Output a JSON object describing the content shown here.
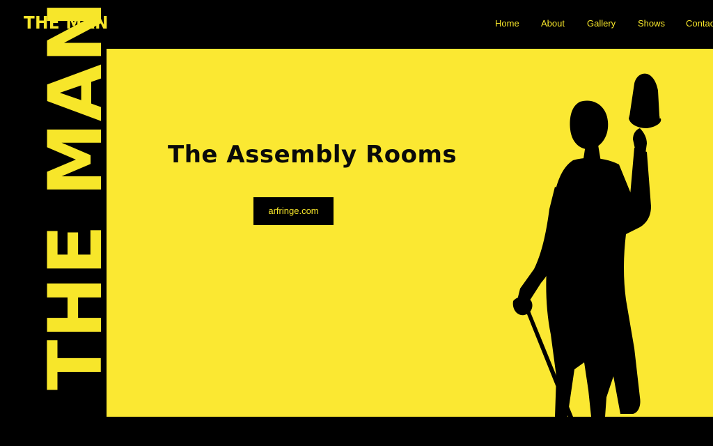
{
  "header": {
    "logo": "THE MAN",
    "nav": {
      "home": "Home",
      "about": "About",
      "gallery": "Gallery",
      "shows": "Shows",
      "contact": "Contac"
    }
  },
  "side": {
    "title": "THE MAN"
  },
  "hero": {
    "title": "The Assembly Rooms",
    "cta_label": "arfringe.com",
    "image": "performer-silhouette-with-hat-and-cane"
  },
  "colors": {
    "accent_yellow": "#fbe832",
    "text_yellow": "#f7e62a",
    "black": "#000000"
  }
}
